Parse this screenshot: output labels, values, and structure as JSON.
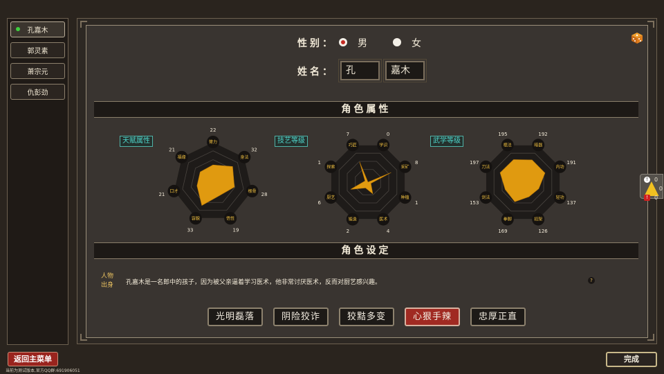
{
  "characters": [
    {
      "name": "孔嘉木",
      "active": true
    },
    {
      "name": "郭灵素",
      "active": false
    },
    {
      "name": "萧宗元",
      "active": false
    },
    {
      "name": "仇彭劲",
      "active": false
    }
  ],
  "gender": {
    "label": "性别：",
    "male": "男",
    "female": "女",
    "selected": "男"
  },
  "name": {
    "label": "姓名：",
    "surname": "孔",
    "given": "嘉木"
  },
  "sections": {
    "attributes": "角色属性",
    "setting": "角色设定"
  },
  "charts": [
    {
      "tag": "天赋属性",
      "labels": [
        "膂力",
        "身法",
        "根骨",
        "悟性",
        "容貌",
        "口才",
        "福缘"
      ],
      "values": [
        22,
        32,
        28,
        19,
        33,
        21,
        21
      ]
    },
    {
      "tag": "技艺等级",
      "labels": [
        "学识",
        "采矿",
        "种植",
        "医术",
        "锻造",
        "厨艺",
        "探索",
        "巧匠"
      ],
      "values": [
        0,
        8,
        1,
        4,
        2,
        6,
        1,
        7
      ]
    },
    {
      "tag": "武学等级",
      "labels": [
        "暗器",
        "内功",
        "轻功",
        "招架",
        "拳脚",
        "剑法",
        "刀法",
        "棍法"
      ],
      "values": [
        192,
        191,
        137,
        126,
        169,
        153,
        197,
        195
      ]
    }
  ],
  "background": {
    "label_line1": "人物",
    "label_line2": "出身",
    "text": "孔嘉木是一名郎中的孩子，因为被父亲逼着学习医术，他非常讨厌医术，反而对厨艺感兴趣。"
  },
  "traits": [
    {
      "label": "光明磊落",
      "selected": false
    },
    {
      "label": "阴险狡诈",
      "selected": false
    },
    {
      "label": "狡黠多变",
      "selected": false
    },
    {
      "label": "心狠手辣",
      "selected": true
    },
    {
      "label": "忠厚正直",
      "selected": false
    }
  ],
  "notices": {
    "info": "0",
    "warning": "0",
    "error": "0"
  },
  "buttons": {
    "back": "返回主菜单",
    "done": "完成"
  },
  "footer": "当前为测试版本,官方QQ群:691906051",
  "colors": {
    "accent_orange": "#e09a10",
    "selected_red": "#a02a22",
    "tag_teal": "#4fd6cc"
  }
}
